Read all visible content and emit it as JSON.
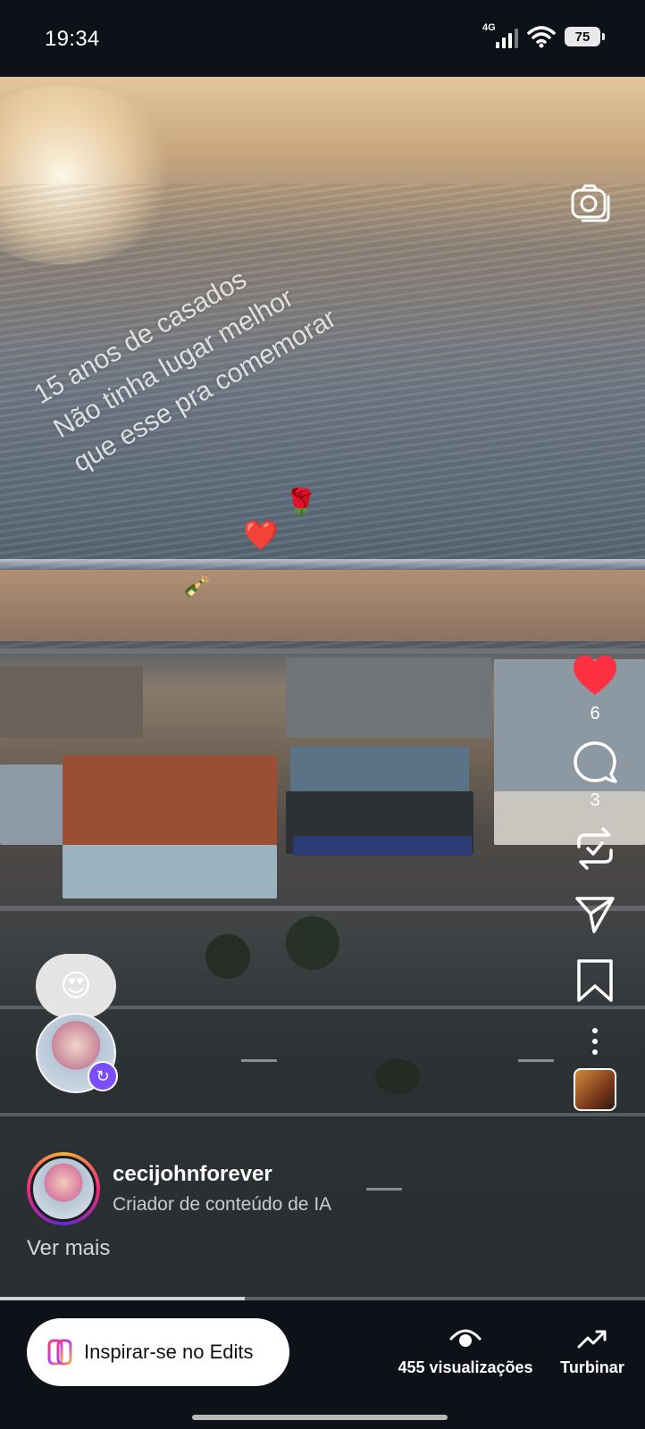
{
  "status_bar": {
    "time": "19:34",
    "network": "4G",
    "battery": "75"
  },
  "video": {
    "overlay_lines": [
      "15 anos de casados",
      "Não tinha lugar melhor",
      "que esse pra comemorar"
    ],
    "playback_progress": 0.38
  },
  "actions": {
    "likes": "6",
    "comments": "3",
    "liked": true,
    "like_color": "#ff3040"
  },
  "reaction": {
    "emoji": "😍"
  },
  "author": {
    "username": "cecijohnforever",
    "subtitle": "Criador de conteúdo de IA",
    "see_more": "Ver mais"
  },
  "bottom_bar": {
    "edits_label": "Inspirar-se no Edits",
    "views_label": "455 visualizações",
    "boost_label": "Turbinar"
  },
  "colors": {
    "background": "#0e1117",
    "accent_badge": "#7a4dff"
  }
}
